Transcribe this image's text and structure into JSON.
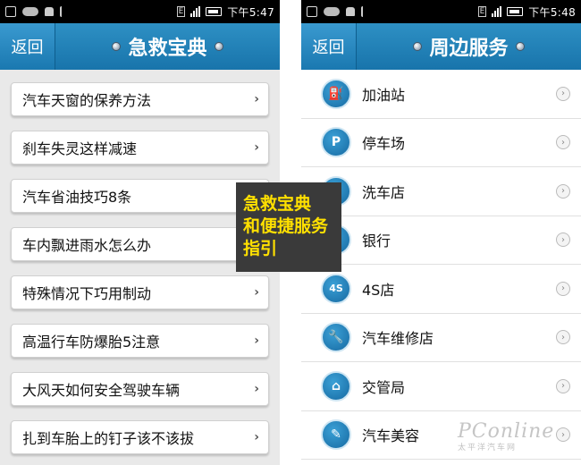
{
  "left_screen": {
    "status": {
      "time": "下午5:47",
      "network": "E"
    },
    "header": {
      "back_label": "返回",
      "title": "急救宝典"
    },
    "items": [
      {
        "label": "汽车天窗的保养方法"
      },
      {
        "label": "刹车失灵这样减速"
      },
      {
        "label": "汽车省油技巧8条"
      },
      {
        "label": "车内飘进雨水怎么办"
      },
      {
        "label": "特殊情况下巧用制动"
      },
      {
        "label": "高温行车防爆胎5注意"
      },
      {
        "label": "大风天如何安全驾驶车辆"
      },
      {
        "label": "扎到车胎上的钉子该不该拔"
      }
    ]
  },
  "right_screen": {
    "status": {
      "time": "下午5:48",
      "network": "E"
    },
    "header": {
      "back_label": "返回",
      "title": "周边服务"
    },
    "items": [
      {
        "label": "加油站",
        "icon": "fuel-pump-icon",
        "glyph": "⛽"
      },
      {
        "label": "停车场",
        "icon": "parking-icon",
        "glyph": "P"
      },
      {
        "label": "洗车店",
        "icon": "car-wash-icon",
        "glyph": "●"
      },
      {
        "label": "银行",
        "icon": "bank-yen-icon",
        "glyph": "¥"
      },
      {
        "label": "4S店",
        "icon": "dealership-4s-icon",
        "glyph": "4S"
      },
      {
        "label": "汽车维修店",
        "icon": "wrench-icon",
        "glyph": "🔧"
      },
      {
        "label": "交管局",
        "icon": "house-icon",
        "glyph": "⌂"
      },
      {
        "label": "汽车美容",
        "icon": "beauty-brush-icon",
        "glyph": "✎"
      }
    ]
  },
  "overlay": {
    "lines": [
      "急救宝典",
      "和便捷服务",
      "指引"
    ]
  },
  "watermark": {
    "logo": "PConline",
    "sub": "太平洋汽车网"
  },
  "colors": {
    "header": "#1e7fb8",
    "overlay_text": "#ffe000",
    "overlay_bg": "#3a3a3a"
  }
}
